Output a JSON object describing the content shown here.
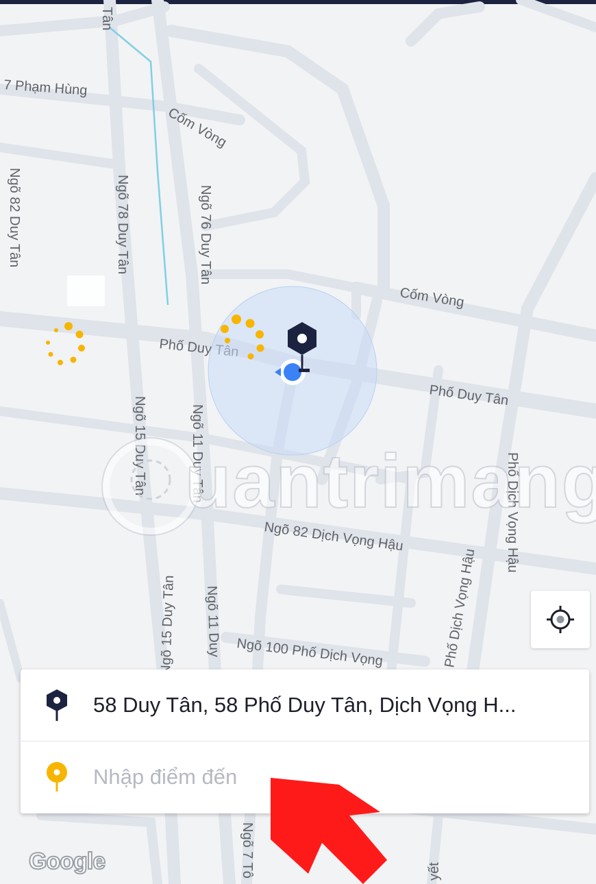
{
  "colors": {
    "pickup_pin": "#1c2340",
    "destination_pin": "#f7b500",
    "user_dot": "#3b82f6",
    "accuracy_circle": "#c9dcf5",
    "road": "#dfe3ea",
    "arrow": "#ff1a1a"
  },
  "map": {
    "streets": {
      "pham_hung": "7 Phạm Hùng",
      "com_vong_1": "Cốm Vòng",
      "com_vong_2": "Cốm Vòng",
      "pho_duy_tan_1": "Phố Duy Tân",
      "pho_duy_tan_2": "Phố Duy Tân",
      "ngo_82_duy_tan": "Ngõ 82 Duy Tân",
      "ngo_78_duy_tan": "Ngõ 78 Duy Tân",
      "ngo_76_duy_tan": "Ngõ 76 Duy Tân",
      "ngo_15_duy_tan_1": "Ngõ 15 Duy Tân",
      "ngo_11_duy_tan_1": "Ngõ 11 Duy Tân",
      "ngo_82_dich_vong_hau": "Ngõ 82 Dịch Vọng Hậu",
      "pho_dich_vong_hau_1": "Phố Dịch Vọng Hậu",
      "pho_dich_vong_hau_2": "Phố Dịch Vọng Hậu",
      "ngo_15_duy_tan_2": "Ngõ 15 Duy Tân",
      "ngo_11_duy_tan_2": "Ngõ 11 Duy",
      "ngo_100": "Ngõ 100 Phố Dịch Vọng",
      "ngo_7": "Ngõ 7 Tô",
      "duyet": "yết",
      "tan_top": "Tân"
    },
    "watermark": "uantrimang",
    "google_logo": "Google"
  },
  "icons": {
    "pickup": "pickup-pin-icon",
    "destination": "destination-pin-icon",
    "locate": "crosshair-locate-icon",
    "user": "user-location-dot-icon",
    "loading": "loading-spinner-icon"
  },
  "pickup": {
    "address": "58 Duy Tân, 58 Phố Duy Tân, Dịch Vọng H..."
  },
  "destination": {
    "placeholder": "Nhập điểm đến"
  }
}
